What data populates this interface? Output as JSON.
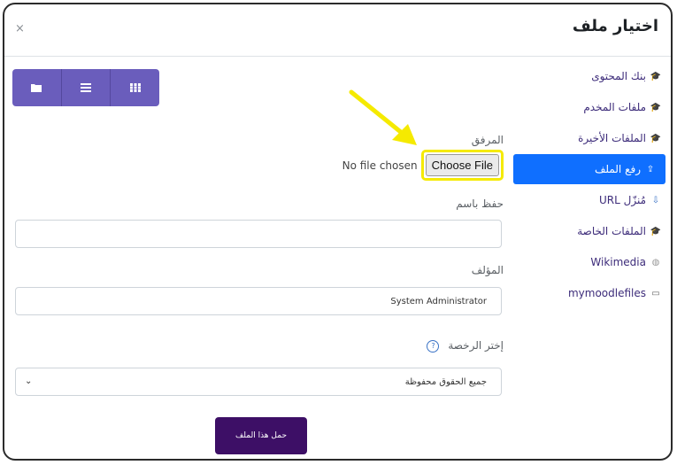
{
  "dialog": {
    "title": "اختيار ملف",
    "close_label": "×"
  },
  "sidebar": {
    "items": [
      {
        "label": "بنك المحتوى",
        "icon": "moodle-icon"
      },
      {
        "label": "ملفات المخدم",
        "icon": "moodle-icon"
      },
      {
        "label": "الملفات الأخيرة",
        "icon": "moodle-icon"
      },
      {
        "label": "رفع الملف",
        "icon": "upload-icon",
        "active": true
      },
      {
        "label": "مُنزّل URL",
        "icon": "download-icon"
      },
      {
        "label": "الملفات الخاصة",
        "icon": "moodle-icon"
      },
      {
        "label": "Wikimedia",
        "icon": "wikimedia-icon"
      },
      {
        "label": "mymoodlefiles",
        "icon": "file-icon"
      }
    ]
  },
  "toolbar": {
    "buttons": [
      "folder-icon",
      "list-icon",
      "grid-icon"
    ]
  },
  "form": {
    "attachment_label": "المرفق",
    "no_file_text": "No file chosen",
    "choose_file_label": "Choose File",
    "save_as_label": "حفظ باسم",
    "save_as_value": "",
    "author_label": "المؤلف",
    "author_value": "System Administrator",
    "license_label": "إختر الرخصة",
    "license_value": "جميع الحقوق محفوظة",
    "submit_label": "حمل هذا الملف"
  },
  "colors": {
    "accent": "#0f6fff",
    "toolbar": "#6a5dbc",
    "submit": "#3d0f66",
    "highlight": "#f5ea00"
  }
}
